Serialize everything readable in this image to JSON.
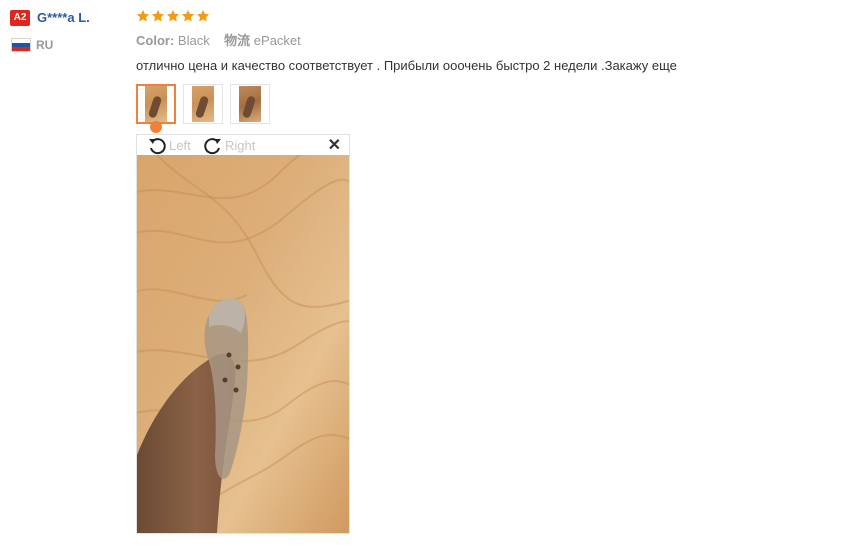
{
  "reviewer": {
    "level": "A2",
    "name": "G****a L.",
    "country": "RU",
    "flag_colors": [
      "#ffffff",
      "#1c57a5",
      "#d52b1e"
    ]
  },
  "review": {
    "rating": 5,
    "rating_max": 5,
    "star_color": "#f39c12",
    "color_label": "Color:",
    "color_value": "Black",
    "shipping_label": "物流",
    "shipping_value": "ePacket",
    "text": "отлично цена и качество соответствует . Прибыли ооочень быстро 2 недели .Закажу еще"
  },
  "thumbnails": [
    {
      "icon": "photo-thumbnail",
      "active": true
    },
    {
      "icon": "photo-thumbnail",
      "active": false
    },
    {
      "icon": "photo-thumbnail",
      "active": false
    }
  ],
  "viewer": {
    "rotate_left_label": "Left",
    "rotate_right_label": "Right",
    "close_icon": "close-icon",
    "accent": "#f0813a"
  }
}
